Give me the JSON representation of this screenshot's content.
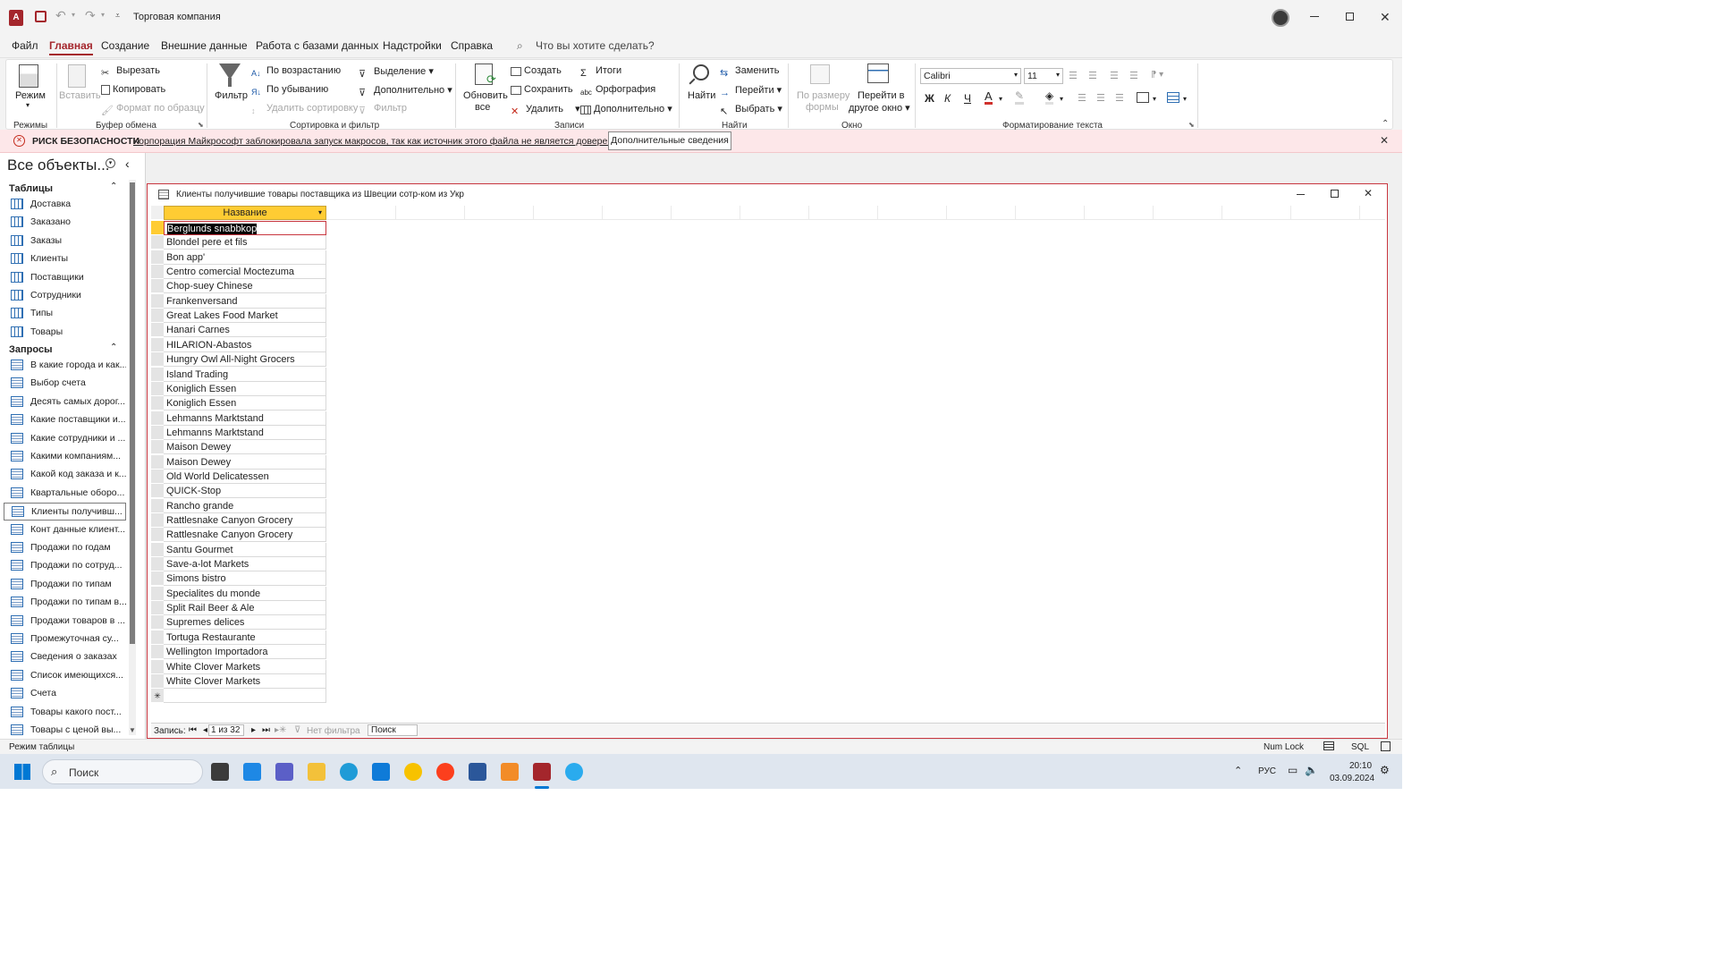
{
  "window": {
    "title": "Торговая компания"
  },
  "menu": {
    "file": "Файл",
    "tabs": [
      "Главная",
      "Создание",
      "Внешние данные",
      "Работа с базами данных",
      "Надстройки",
      "Справка"
    ],
    "search_placeholder": "Что вы хотите сделать?"
  },
  "ribbon": {
    "views": {
      "mode": "Режим",
      "label": "Режимы"
    },
    "clipboard": {
      "paste": "Вставить",
      "cut": "Вырезать",
      "copy": "Копировать",
      "format": "Формат по образцу",
      "label": "Буфер обмена"
    },
    "sort": {
      "filter": "Фильтр",
      "asc": "По возрастанию",
      "desc": "По убыванию",
      "remove": "Удалить сортировку",
      "selection": "Выделение",
      "advanced": "Дополнительно",
      "toggle": "Фильтр",
      "label": "Сортировка и фильтр"
    },
    "records": {
      "refresh": "Обновить",
      "refresh2": "все",
      "new": "Создать",
      "save": "Сохранить",
      "delete": "Удалить",
      "totals": "Итоги",
      "spelling": "Орфография",
      "more": "Дополнительно",
      "label": "Записи"
    },
    "find": {
      "find": "Найти",
      "replace": "Заменить",
      "goto": "Перейти",
      "select": "Выбрать",
      "label": "Найти"
    },
    "window": {
      "fit": "По размеру",
      "fit2": "формы",
      "switch": "Перейти в",
      "switch2": "другое окно",
      "label": "Окно"
    },
    "text": {
      "font": "Calibri",
      "size": "11",
      "bold": "Ж",
      "italic": "К",
      "underline": "Ч",
      "label": "Форматирование текста"
    }
  },
  "security": {
    "title": "РИСК БЕЗОПАСНОСТИ",
    "message": "Корпорация Майкрософт заблокировала запуск макросов, так как источник этого файла не является доверенным.",
    "button": "Дополнительные сведения"
  },
  "nav": {
    "header": "Все объекты...",
    "tables_label": "Таблицы",
    "tables": [
      "Доставка",
      "Заказано",
      "Заказы",
      "Клиенты",
      "Поставщики",
      "Сотрудники",
      "Типы",
      "Товары"
    ],
    "queries_label": "Запросы",
    "queries": [
      "В какие города и как...",
      "Выбор счета",
      "Десять самых дорог...",
      "Какие поставщики и...",
      "Какие сотрудники и ...",
      "Какими компаниям...",
      "Какой код заказа и к...",
      "Квартальные оборо...",
      "Клиенты получивш...",
      "Конт данные клиент...",
      "Продажи по годам",
      "Продажи по сотруд...",
      "Продажи по типам",
      "Продажи по типам в...",
      "Продажи товаров в ...",
      "Промежуточная су...",
      "Сведения о заказах",
      "Список имеющихся...",
      "Счета",
      "Товары какого пост...",
      "Товары с ценой вы..."
    ]
  },
  "document": {
    "title": "Клиенты получившие товары поставщика из Швеции сотр-ком из Укр",
    "column": "Название",
    "rows": [
      "Berglunds snabbkop",
      "Blondel pere et fils",
      "Bon app'",
      "Centro comercial Moctezuma",
      "Chop-suey Chinese",
      "Frankenversand",
      "Great Lakes Food Market",
      "Hanari Carnes",
      "HILARION-Abastos",
      "Hungry Owl All-Night Grocers",
      "Island Trading",
      "Koniglich Essen",
      "Koniglich Essen",
      "Lehmanns Marktstand",
      "Lehmanns Marktstand",
      "Maison Dewey",
      "Maison Dewey",
      "Old World Delicatessen",
      "QUICK-Stop",
      "Rancho grande",
      "Rattlesnake Canyon Grocery",
      "Rattlesnake Canyon Grocery",
      "Santu Gourmet",
      "Save-a-lot Markets",
      "Simons bistro",
      "Specialites du monde",
      "Split Rail Beer & Ale",
      "Supremes delices",
      "Tortuga Restaurante",
      "Wellington Importadora",
      "White Clover Markets",
      "White Clover Markets"
    ],
    "new_row_marker": "✳",
    "record_label": "Запись:",
    "record_pos": "1 из 32",
    "no_filter": "Нет фильтра",
    "search": "Поиск"
  },
  "status": {
    "mode": "Режим таблицы",
    "numlock": "Num Lock",
    "sql": "SQL"
  },
  "taskbar": {
    "search": "Поиск",
    "lang": "РУС",
    "time": "20:10",
    "date": "03.09.2024"
  }
}
